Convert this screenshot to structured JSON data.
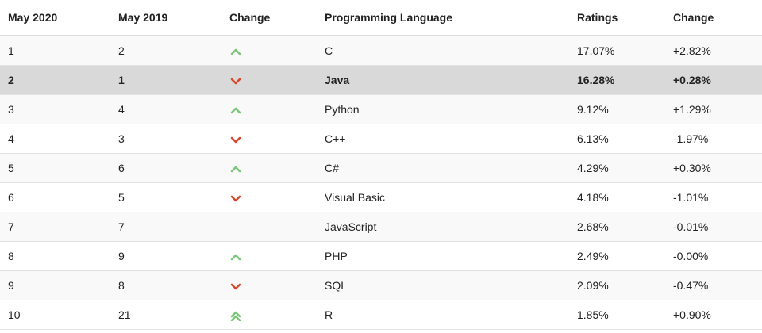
{
  "table": {
    "headers": [
      "May 2020",
      "May 2019",
      "Change",
      "Programming Language",
      "Ratings",
      "Change"
    ],
    "rows": [
      {
        "may2020": "1",
        "may2019": "2",
        "trend": "up",
        "language": "C",
        "ratings": "17.07%",
        "change": "+2.82%",
        "highlight": false
      },
      {
        "may2020": "2",
        "may2019": "1",
        "trend": "down",
        "language": "Java",
        "ratings": "16.28%",
        "change": "+0.28%",
        "highlight": true
      },
      {
        "may2020": "3",
        "may2019": "4",
        "trend": "up",
        "language": "Python",
        "ratings": "9.12%",
        "change": "+1.29%",
        "highlight": false
      },
      {
        "may2020": "4",
        "may2019": "3",
        "trend": "down",
        "language": "C++",
        "ratings": "6.13%",
        "change": "-1.97%",
        "highlight": false
      },
      {
        "may2020": "5",
        "may2019": "6",
        "trend": "up",
        "language": "C#",
        "ratings": "4.29%",
        "change": "+0.30%",
        "highlight": false
      },
      {
        "may2020": "6",
        "may2019": "5",
        "trend": "down",
        "language": "Visual Basic",
        "ratings": "4.18%",
        "change": "-1.01%",
        "highlight": false
      },
      {
        "may2020": "7",
        "may2019": "7",
        "trend": "none",
        "language": "JavaScript",
        "ratings": "2.68%",
        "change": "-0.01%",
        "highlight": false
      },
      {
        "may2020": "8",
        "may2019": "9",
        "trend": "up",
        "language": "PHP",
        "ratings": "2.49%",
        "change": "-0.00%",
        "highlight": false
      },
      {
        "may2020": "9",
        "may2019": "8",
        "trend": "down",
        "language": "SQL",
        "ratings": "2.09%",
        "change": "-0.47%",
        "highlight": false
      },
      {
        "may2020": "10",
        "may2019": "21",
        "trend": "double-up",
        "language": "R",
        "ratings": "1.85%",
        "change": "+0.90%",
        "highlight": false
      }
    ]
  },
  "icons": {
    "up": "chevron-up-icon",
    "down": "chevron-down-icon",
    "double-up": "double-chevron-up-icon"
  },
  "colors": {
    "up": "#7cc67a",
    "down": "#d9472b",
    "highlight_row": "#d9d9d9"
  }
}
